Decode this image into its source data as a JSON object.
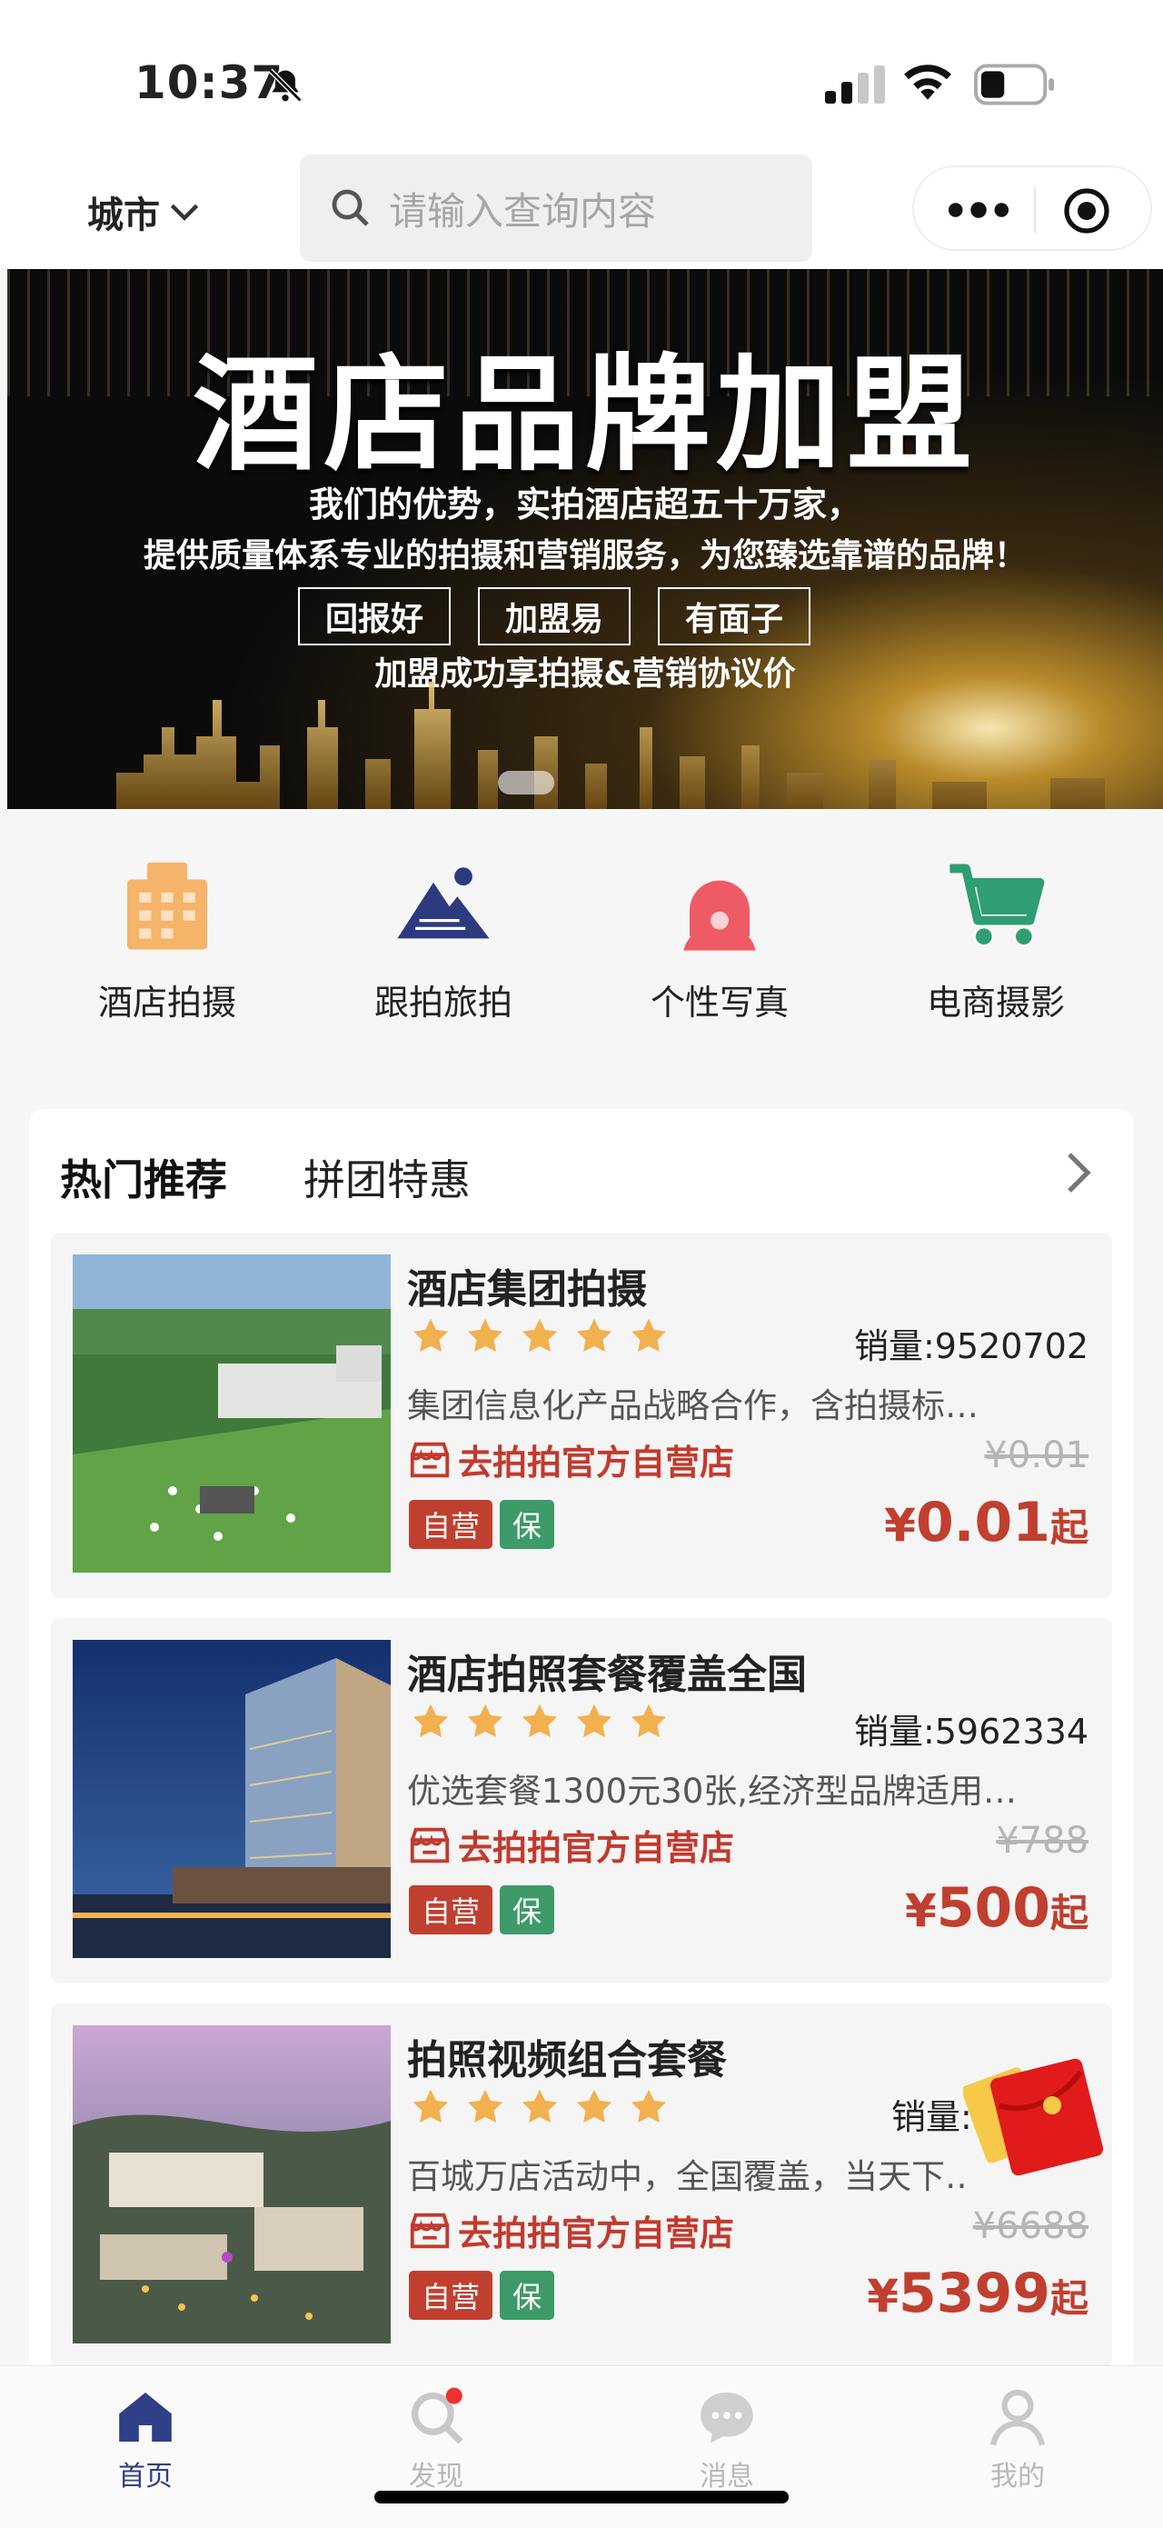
{
  "status_bar": {
    "time": "10:37"
  },
  "header": {
    "city_label": "城市",
    "search_placeholder": "请输入查询内容"
  },
  "banner": {
    "title": "酒店品牌加盟",
    "line1": "我们的优势，实拍酒店超五十万家，",
    "line2": "提供质量体系专业的拍摄和营销服务，为您臻选靠谱的品牌！",
    "tags": [
      "回报好",
      "加盟易",
      "有面子"
    ],
    "footer": "加盟成功享拍摄&营销协议价"
  },
  "categories": [
    {
      "label": "酒店拍摄",
      "icon": "hotel-building-icon"
    },
    {
      "label": "跟拍旅拍",
      "icon": "mountain-icon"
    },
    {
      "label": "个性写真",
      "icon": "portrait-icon"
    },
    {
      "label": "电商摄影",
      "icon": "shopping-cart-icon"
    }
  ],
  "recommend": {
    "tab_hot": "热门推荐",
    "tab_group": "拼团特惠",
    "items": [
      {
        "title": "酒店集团拍摄",
        "rating": 5,
        "sales": "销量:9520702",
        "desc": "集团信息化产品战略合作，含拍摄标…",
        "shop": "去拍拍官方自营店",
        "orig_price": "¥0.01",
        "badge_self": "自营",
        "badge_guarantee": "保",
        "price_currency": "¥",
        "price": "0.01",
        "price_suffix": "起"
      },
      {
        "title": "酒店拍照套餐覆盖全国",
        "rating": 5,
        "sales": "销量:5962334",
        "desc": "优选套餐1300元30张,经济型品牌适用…",
        "shop": "去拍拍官方自营店",
        "orig_price": "¥788",
        "badge_self": "自营",
        "badge_guarantee": "保",
        "price_currency": "¥",
        "price": "500",
        "price_suffix": "起"
      },
      {
        "title": "拍照视频组合套餐",
        "rating": 5,
        "sales": "销量:5",
        "desc": "百城万店活动中，全国覆盖，当天下…",
        "shop": "去拍拍官方自营店",
        "orig_price": "¥6688",
        "badge_self": "自营",
        "badge_guarantee": "保",
        "price_currency": "¥",
        "price": "5399",
        "price_suffix": "起"
      }
    ]
  },
  "tabbar": [
    {
      "label": "首页",
      "icon": "home-icon",
      "active": true
    },
    {
      "label": "发现",
      "icon": "discover-search-icon",
      "active": false
    },
    {
      "label": "消息",
      "icon": "message-icon",
      "active": false
    },
    {
      "label": "我的",
      "icon": "profile-icon",
      "active": false
    }
  ],
  "colors": {
    "accent_red": "#c13f2f",
    "accent_green": "#3e9a68",
    "nav_active": "#2f3f88",
    "star": "#f2b04e"
  }
}
